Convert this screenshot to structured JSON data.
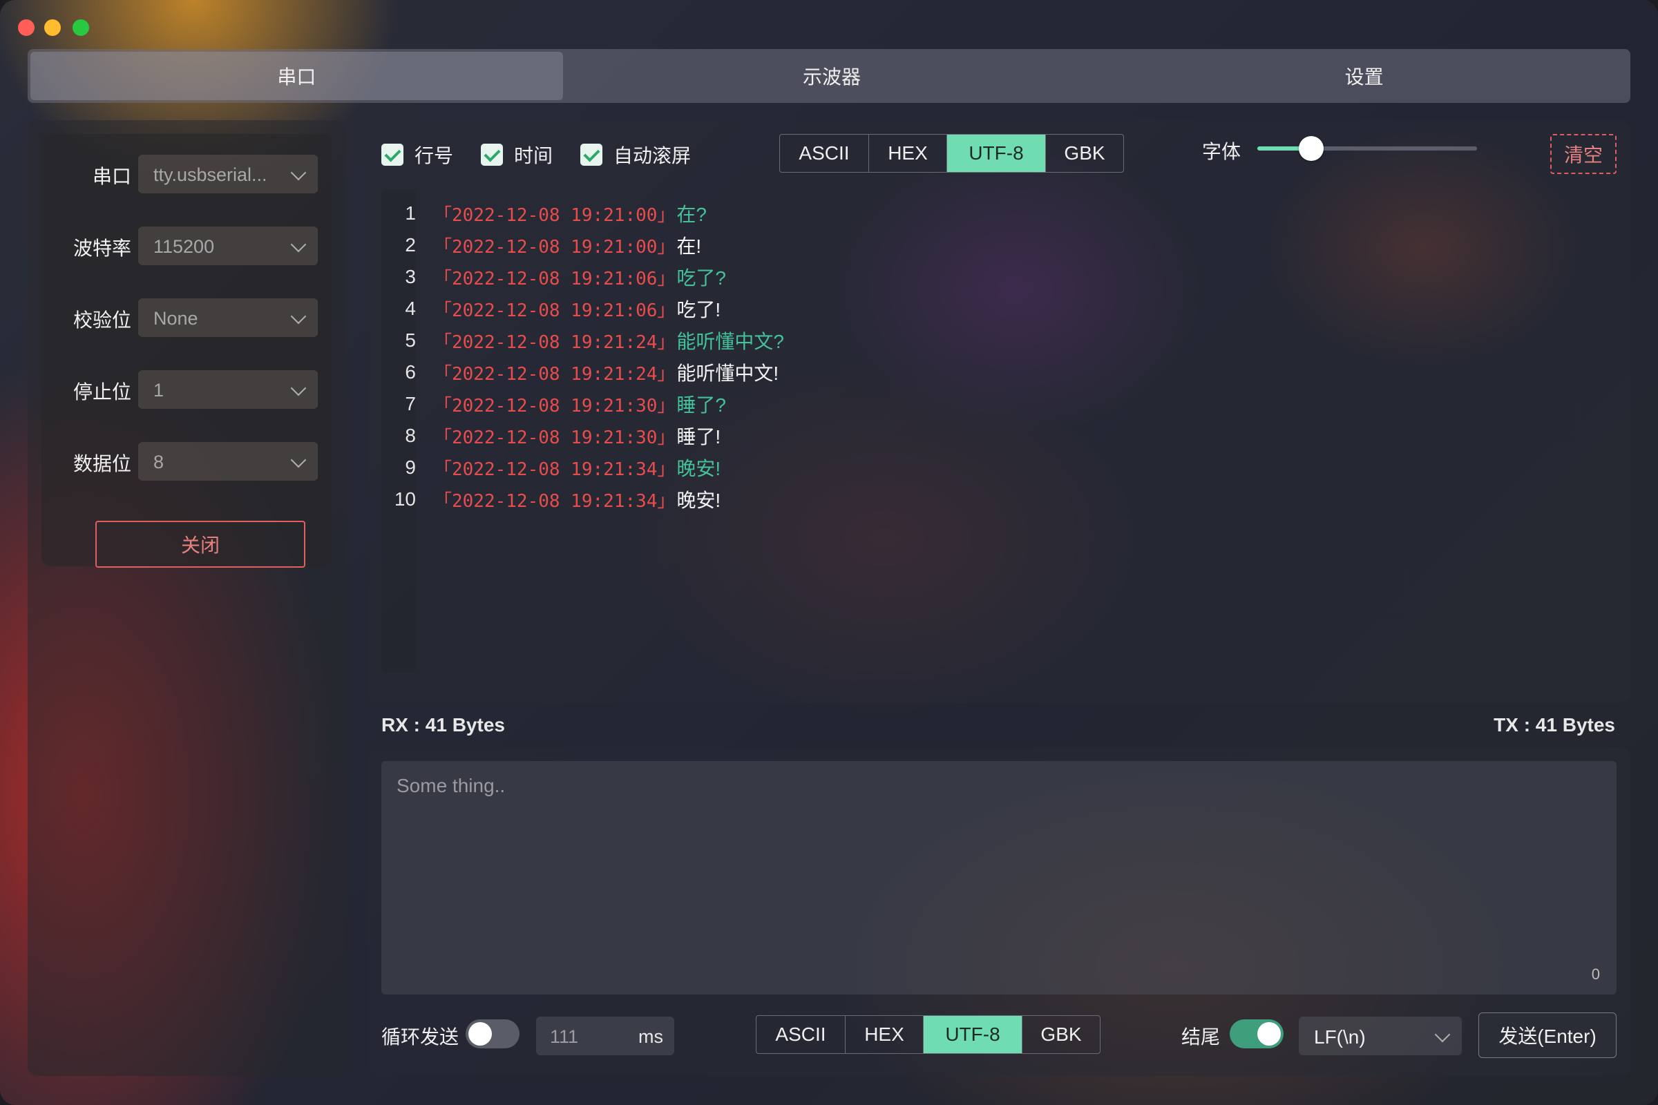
{
  "tabs": [
    {
      "label": "串口",
      "active": true
    },
    {
      "label": "示波器",
      "active": false
    },
    {
      "label": "设置",
      "active": false
    }
  ],
  "serial_config": {
    "fields": [
      {
        "label": "串口",
        "value": "tty.usbserial..."
      },
      {
        "label": "波特率",
        "value": "115200"
      },
      {
        "label": "校验位",
        "value": "None"
      },
      {
        "label": "停止位",
        "value": "1"
      },
      {
        "label": "数据位",
        "value": "8"
      }
    ],
    "close_label": "关闭"
  },
  "display_options": {
    "checkboxes": [
      {
        "label": "行号",
        "checked": true
      },
      {
        "label": "时间",
        "checked": true
      },
      {
        "label": "自动滚屏",
        "checked": true
      }
    ],
    "encodings": [
      "ASCII",
      "HEX",
      "UTF-8",
      "GBK"
    ],
    "selected_encoding": "UTF-8",
    "font_label": "字体",
    "font_slider_value": 0.2,
    "clear_label": "清空"
  },
  "log": [
    {
      "line": "1",
      "time": "「2022-12-08 19:21:00」",
      "text": "在?",
      "dir": "rx"
    },
    {
      "line": "2",
      "time": "「2022-12-08 19:21:00」",
      "text": "在!",
      "dir": "tx"
    },
    {
      "line": "3",
      "time": "「2022-12-08 19:21:06」",
      "text": "吃了?",
      "dir": "rx"
    },
    {
      "line": "4",
      "time": "「2022-12-08 19:21:06」",
      "text": "吃了!",
      "dir": "tx"
    },
    {
      "line": "5",
      "time": "「2022-12-08 19:21:24」",
      "text": "能听懂中文?",
      "dir": "rx"
    },
    {
      "line": "6",
      "time": "「2022-12-08 19:21:24」",
      "text": "能听懂中文!",
      "dir": "tx"
    },
    {
      "line": "7",
      "time": "「2022-12-08 19:21:30」",
      "text": "睡了?",
      "dir": "rx"
    },
    {
      "line": "8",
      "time": "「2022-12-08 19:21:30」",
      "text": "睡了!",
      "dir": "tx"
    },
    {
      "line": "9",
      "time": "「2022-12-08 19:21:34」",
      "text": "晚安!",
      "dir": "rx"
    },
    {
      "line": "10",
      "time": "「2022-12-08 19:21:34」",
      "text": "晚安!",
      "dir": "tx"
    }
  ],
  "stats": {
    "rx": "RX : 41 Bytes",
    "tx": "TX : 41 Bytes"
  },
  "send": {
    "placeholder": "Some thing..",
    "char_count": "0",
    "loop_label": "循环发送",
    "loop_enabled": false,
    "interval_value": "111",
    "interval_unit": "ms",
    "encodings": [
      "ASCII",
      "HEX",
      "UTF-8",
      "GBK"
    ],
    "selected_encoding": "UTF-8",
    "ending_label": "结尾",
    "ending_enabled": true,
    "ending_value": "LF(\\n)",
    "send_label": "发送(Enter)"
  },
  "colors": {
    "accent": "#6fdcb2",
    "timestamp": "#e84c4c",
    "rx_text": "#43c29a",
    "danger": "#e06060"
  }
}
